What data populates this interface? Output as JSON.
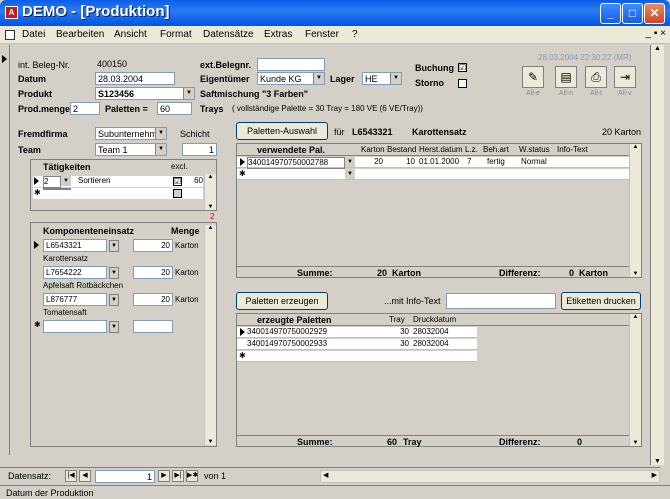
{
  "window": {
    "title": "DEMO - [Produktion]",
    "app_icon": "access-app-icon"
  },
  "menu": [
    "Datei",
    "Bearbeiten",
    "Ansicht",
    "Format",
    "Datensätze",
    "Extras",
    "Fenster",
    "?"
  ],
  "doc_controls": "_ ▪ ×",
  "header": {
    "int_beleg_label": "int. Beleg-Nr.",
    "int_beleg_value": "400150",
    "ext_beleg_label": "ext.Belegnr.",
    "ext_beleg_value": "",
    "datum_label": "Datum",
    "datum_value": "28.03.2004",
    "eigentuemer_label": "Eigentümer",
    "eigentuemer_value": "Kunde KG",
    "lager_label": "Lager",
    "lager_value": "HE",
    "produkt_label": "Produkt",
    "produkt_value": "S123456",
    "produkt_desc": "Saftmischung \"3 Farben\"",
    "prodmenge_label": "Prod.menge",
    "prodmenge_value": "2",
    "paletten_label": "Paletten =",
    "paletten_value": "60",
    "trays_text": "Trays",
    "vollst_text": "( vollständige Palette  =     30  Tray   =      180  VE  (6 VE/Tray))",
    "buchung_label": "Buchung",
    "buchung_checked": "☑",
    "storno_label": "Storno",
    "storno_checked": "",
    "timestamp": "28.03.2004 22:30:22 (MR)"
  },
  "toolbar_buttons": [
    {
      "icon": "pencil-icon",
      "glyph": "✎",
      "label": "All-e"
    },
    {
      "icon": "register-icon",
      "glyph": "▤",
      "label": "All-n"
    },
    {
      "icon": "printer-icon",
      "glyph": "⎙",
      "label": "All-t"
    },
    {
      "icon": "exit-door-icon",
      "glyph": "⇥",
      "label": "All-v"
    }
  ],
  "fremd": {
    "fremdfirma_label": "Fremdfirma",
    "fremdfirma_value": "Subunternehm",
    "schicht_label": "Schicht",
    "team_label": "Team",
    "team_value": "Team 1",
    "schicht_value": "1"
  },
  "taetigkeiten": {
    "title": "Tätigkeiten",
    "excl_label": "excl.",
    "rows": [
      {
        "nr": "2",
        "name": "Sortieren",
        "excl": "☑",
        "value": "60"
      }
    ]
  },
  "komponenten": {
    "title": "Komponenteneinsatz",
    "menge_label": "Menge",
    "red_mark": "2",
    "rows": [
      {
        "code": "L6543321",
        "menge": "20",
        "unit": "Karton",
        "desc": "Karottensatz"
      },
      {
        "code": "L7654222",
        "menge": "20",
        "unit": "Karton",
        "desc": "Apfelsaft Rotbäckchen"
      },
      {
        "code": "L876777",
        "menge": "20",
        "unit": "Karton",
        "desc": "Tomatensaft"
      }
    ]
  },
  "paletten_auswahl": {
    "button": "Paletten-Auswahl",
    "fuer": "für",
    "code": "L6543321",
    "name": "Karottensatz",
    "count": "20 Karton"
  },
  "verwendete": {
    "headers": [
      "verwendete Pal.",
      "Karton",
      "Bestand",
      "Herst.datum",
      "L.z.",
      "Beh.art",
      "W.status",
      "Info-Text"
    ],
    "rows": [
      {
        "pal": "340014970750002788",
        "karton": "20",
        "bestand": "10",
        "herst": "01.01.2000",
        "lz": "7",
        "beh": "fertig",
        "wstatus": "Normal",
        "info": ""
      }
    ],
    "summe_label": "Summe:",
    "summe_value": "20",
    "summe_unit": "Karton",
    "diff_label": "Differenz:",
    "diff_value": "0",
    "diff_unit": "Karton"
  },
  "erzeugte": {
    "button_erzeugen": "Paletten erzeugen",
    "info_label": "...mit Info-Text",
    "info_value": "",
    "button_etiketten": "Etiketten drucken",
    "headers": [
      "erzeugte Paletten",
      "Tray",
      "Druckdatum"
    ],
    "rows": [
      {
        "pal": "340014970750002929",
        "tray": "30",
        "datum": "28032004"
      },
      {
        "pal": "340014970750002933",
        "tray": "30",
        "datum": "28032004"
      }
    ],
    "summe_label": "Summe:",
    "summe_value": "60",
    "summe_unit": "Tray",
    "diff_label": "Differenz:",
    "diff_value": "0"
  },
  "nav": {
    "label": "Datensatz:",
    "record": "1",
    "of": "von 1"
  },
  "status": "Datum der Produktion"
}
